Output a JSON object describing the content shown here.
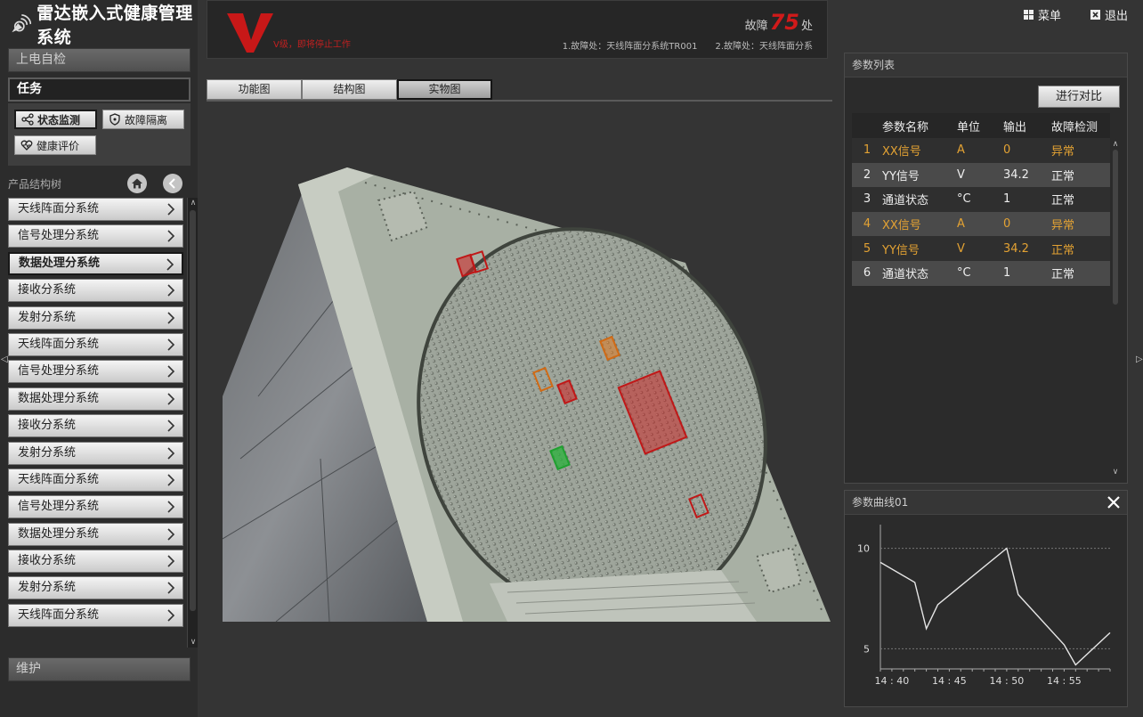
{
  "app": {
    "title": "雷达嵌入式健康管理系统"
  },
  "topbar": {
    "menu_label": "菜单",
    "exit_label": "退出"
  },
  "sidebar": {
    "power_check_label": "上电自检",
    "task_label": "任务",
    "task_buttons": {
      "status_monitor": "状态监测",
      "fault_isolation": "故障隔离",
      "health_eval": "健康评价"
    },
    "tree_title": "产品结构树",
    "tree_items": [
      "天线阵面分系统",
      "信号处理分系统",
      "数据处理分系统",
      "接收分系统",
      "发射分系统",
      "天线阵面分系统",
      "信号处理分系统",
      "数据处理分系统",
      "接收分系统",
      "发射分系统",
      "天线阵面分系统",
      "信号处理分系统",
      "数据处理分系统",
      "接收分系统",
      "发射分系统",
      "天线阵面分系统"
    ],
    "tree_active_index": 2,
    "maintenance_label": "维护"
  },
  "alarm": {
    "level": "V",
    "level_text": "V级，即将停止工作",
    "fault_prefix": "故障",
    "fault_count": "75",
    "fault_suffix": "处",
    "items": [
      "1.故障处：天线阵面分系统TR001",
      "2.故障处：天线阵面分系"
    ]
  },
  "tabs": [
    {
      "label": "功能图",
      "active": false
    },
    {
      "label": "结构图",
      "active": false
    },
    {
      "label": "实物图",
      "active": true
    }
  ],
  "params": {
    "title": "参数列表",
    "compare_button": "进行对比",
    "columns": [
      "",
      "参数名称",
      "单位",
      "输出",
      "故障检测"
    ],
    "rows": [
      {
        "idx": "1",
        "name": "XX信号",
        "unit": "A",
        "output": "0",
        "status": "异常",
        "abnormal": true
      },
      {
        "idx": "2",
        "name": "YY信号",
        "unit": "V",
        "output": "34.2",
        "status": "正常",
        "abnormal": false
      },
      {
        "idx": "3",
        "name": "通道状态",
        "unit": "°C",
        "output": "1",
        "status": "正常",
        "abnormal": false
      },
      {
        "idx": "4",
        "name": "XX信号",
        "unit": "A",
        "output": "0",
        "status": "异常",
        "abnormal": true
      },
      {
        "idx": "5",
        "name": "YY信号",
        "unit": "V",
        "output": "34.2",
        "status": "正常",
        "abnormal": true
      },
      {
        "idx": "6",
        "name": "通道状态",
        "unit": "°C",
        "output": "1",
        "status": "正常",
        "abnormal": false
      }
    ]
  },
  "curve": {
    "title": "参数曲线01",
    "chart_data": {
      "type": "line",
      "x": [
        "14:39",
        "14:42",
        "14:43",
        "14:44",
        "14:50",
        "14:51",
        "14:55",
        "14:56",
        "14:59"
      ],
      "series": [
        {
          "values": [
            9.3,
            8.3,
            6.0,
            7.2,
            10.0,
            7.7,
            5.2,
            4.2,
            5.8
          ]
        }
      ],
      "x_ticks": [
        "14 : 40",
        "14 : 45",
        "14 : 50",
        "14 : 55"
      ],
      "y_ticks": [
        "10",
        "5"
      ],
      "ylim": [
        4,
        11
      ],
      "grid": "horizontal dashed at 10 and 5",
      "line_color": "#e6e6e6"
    }
  },
  "colors": {
    "fault_red": "#d01a1a",
    "abnormal": "#e3a233",
    "marker_orange": "#e07a20",
    "marker_green": "#30b040"
  },
  "icons": [
    "radar-logo-icon",
    "menu-grid-icon",
    "exit-icon",
    "share-icon",
    "shield-icon",
    "heart-icon",
    "home-icon",
    "back-icon",
    "chevron-right-icon",
    "close-icon"
  ]
}
